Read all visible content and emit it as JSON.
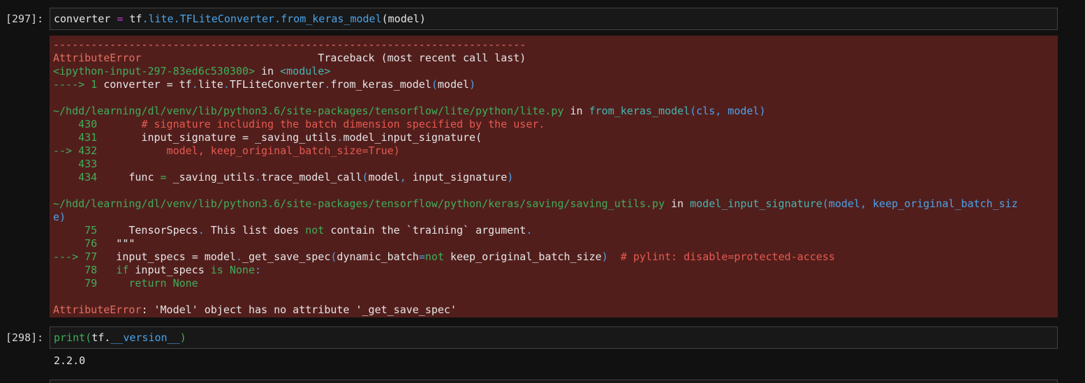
{
  "cells": [
    {
      "prompt": "[297]:",
      "code": [
        {
          "t": "converter ",
          "c": "white"
        },
        {
          "t": "=",
          "c": "purple"
        },
        {
          "t": " tf",
          "c": "white"
        },
        {
          "t": ".",
          "c": "blue"
        },
        {
          "t": "lite",
          "c": "blue"
        },
        {
          "t": ".",
          "c": "blue"
        },
        {
          "t": "TFLiteConverter",
          "c": "blue"
        },
        {
          "t": ".",
          "c": "blue"
        },
        {
          "t": "from_keras_model",
          "c": "blue"
        },
        {
          "t": "(model)",
          "c": "white"
        }
      ]
    },
    {
      "prompt": "[298]:",
      "code": [
        {
          "t": "print",
          "c": "green"
        },
        {
          "t": "(",
          "c": "green"
        },
        {
          "t": "tf",
          "c": "white"
        },
        {
          "t": ".",
          "c": "white"
        },
        {
          "t": "__version__",
          "c": "blue"
        },
        {
          "t": ")",
          "c": "green"
        }
      ],
      "stdout": "2.2.0"
    }
  ],
  "traceback": [
    [
      {
        "t": "---------------------------------------------------------------------------",
        "c": "salmon"
      }
    ],
    [
      {
        "t": "AttributeError",
        "c": "salmon"
      },
      {
        "t": "                            Traceback (most recent call last)",
        "c": "white"
      }
    ],
    [
      {
        "t": "<ipython-input-297-83ed6c530300>",
        "c": "green"
      },
      {
        "t": " in ",
        "c": "white"
      },
      {
        "t": "<module>",
        "c": "teal"
      }
    ],
    [
      {
        "t": "----> 1",
        "c": "green"
      },
      {
        "t": " converter ",
        "c": "white"
      },
      {
        "t": "=",
        "c": "white"
      },
      {
        "t": " tf",
        "c": "white"
      },
      {
        "t": ".",
        "c": "blue"
      },
      {
        "t": "lite",
        "c": "white"
      },
      {
        "t": ".",
        "c": "blue"
      },
      {
        "t": "TFLiteConverter",
        "c": "white"
      },
      {
        "t": ".",
        "c": "blue"
      },
      {
        "t": "from_keras_model",
        "c": "white"
      },
      {
        "t": "(",
        "c": "blue"
      },
      {
        "t": "model",
        "c": "white"
      },
      {
        "t": ")",
        "c": "blue"
      }
    ],
    [
      {
        "t": "",
        "c": "white"
      }
    ],
    [
      {
        "t": "~/hdd/learning/dl/venv/lib/python3.6/site-packages/tensorflow/lite/python/lite.py",
        "c": "green"
      },
      {
        "t": " in ",
        "c": "white"
      },
      {
        "t": "from_keras_model",
        "c": "teal"
      },
      {
        "t": "(cls, model)",
        "c": "blue"
      }
    ],
    [
      {
        "t": "    430",
        "c": "green"
      },
      {
        "t": "       ",
        "c": "white"
      },
      {
        "t": "# signature including the batch dimension specified by the user.",
        "c": "red"
      }
    ],
    [
      {
        "t": "    431",
        "c": "green"
      },
      {
        "t": "       input_signature ",
        "c": "white"
      },
      {
        "t": "=",
        "c": "white"
      },
      {
        "t": " _saving_utils",
        "c": "white"
      },
      {
        "t": ".",
        "c": "blue"
      },
      {
        "t": "model_input_signature",
        "c": "white"
      },
      {
        "t": "(",
        "c": "white"
      }
    ],
    [
      {
        "t": "--> 432",
        "c": "green"
      },
      {
        "t": "           model, keep_original_batch_size=True)",
        "c": "red"
      }
    ],
    [
      {
        "t": "    433",
        "c": "green"
      }
    ],
    [
      {
        "t": "    434",
        "c": "green"
      },
      {
        "t": "     func ",
        "c": "white"
      },
      {
        "t": "=",
        "c": "green"
      },
      {
        "t": " _saving_utils",
        "c": "white"
      },
      {
        "t": ".",
        "c": "blue"
      },
      {
        "t": "trace_model_call",
        "c": "white"
      },
      {
        "t": "(",
        "c": "blue"
      },
      {
        "t": "model",
        "c": "white"
      },
      {
        "t": ",",
        "c": "blue"
      },
      {
        "t": " input_signature",
        "c": "white"
      },
      {
        "t": ")",
        "c": "blue"
      }
    ],
    [
      {
        "t": "",
        "c": "white"
      }
    ],
    [
      {
        "t": "~/hdd/learning/dl/venv/lib/python3.6/site-packages/tensorflow/python/keras/saving/saving_utils.py",
        "c": "green"
      },
      {
        "t": " in ",
        "c": "white"
      },
      {
        "t": "model_input_signature",
        "c": "teal"
      },
      {
        "t": "(model, keep_original_batch_siz",
        "c": "blue"
      }
    ],
    [
      {
        "t": "e)",
        "c": "blue"
      }
    ],
    [
      {
        "t": "     75",
        "c": "green"
      },
      {
        "t": "     TensorSpecs",
        "c": "white"
      },
      {
        "t": ".",
        "c": "blue"
      },
      {
        "t": " This list does ",
        "c": "white"
      },
      {
        "t": "not",
        "c": "green"
      },
      {
        "t": " contain the `training` argument",
        "c": "white"
      },
      {
        "t": ".",
        "c": "blue"
      }
    ],
    [
      {
        "t": "     76",
        "c": "green"
      },
      {
        "t": "   \"\"\"",
        "c": "white"
      }
    ],
    [
      {
        "t": "---> 77",
        "c": "green"
      },
      {
        "t": "   input_specs ",
        "c": "white"
      },
      {
        "t": "=",
        "c": "white"
      },
      {
        "t": " model",
        "c": "white"
      },
      {
        "t": ".",
        "c": "blue"
      },
      {
        "t": "_get_save_spec",
        "c": "white"
      },
      {
        "t": "(",
        "c": "blue"
      },
      {
        "t": "dynamic_batch",
        "c": "white"
      },
      {
        "t": "=",
        "c": "blue"
      },
      {
        "t": "not",
        "c": "green"
      },
      {
        "t": " keep_original_batch_size",
        "c": "white"
      },
      {
        "t": ")",
        "c": "blue"
      },
      {
        "t": "  # pylint: disable=protected-access",
        "c": "red"
      }
    ],
    [
      {
        "t": "     78",
        "c": "green"
      },
      {
        "t": "   ",
        "c": "white"
      },
      {
        "t": "if",
        "c": "green"
      },
      {
        "t": " input_specs ",
        "c": "white"
      },
      {
        "t": "is",
        "c": "green"
      },
      {
        "t": " None",
        "c": "green"
      },
      {
        "t": ":",
        "c": "blue"
      }
    ],
    [
      {
        "t": "     79",
        "c": "green"
      },
      {
        "t": "     ",
        "c": "white"
      },
      {
        "t": "return",
        "c": "green"
      },
      {
        "t": " None",
        "c": "green"
      }
    ],
    [
      {
        "t": "",
        "c": "white"
      }
    ],
    [
      {
        "t": "AttributeError",
        "c": "salmon"
      },
      {
        "t": ": 'Model' object has no attribute '_get_save_spec'",
        "c": "white"
      }
    ]
  ],
  "colors": {
    "background": "#111111",
    "cell_background": "#181818",
    "cell_border": "#424242",
    "error_background": "#521e1c"
  }
}
